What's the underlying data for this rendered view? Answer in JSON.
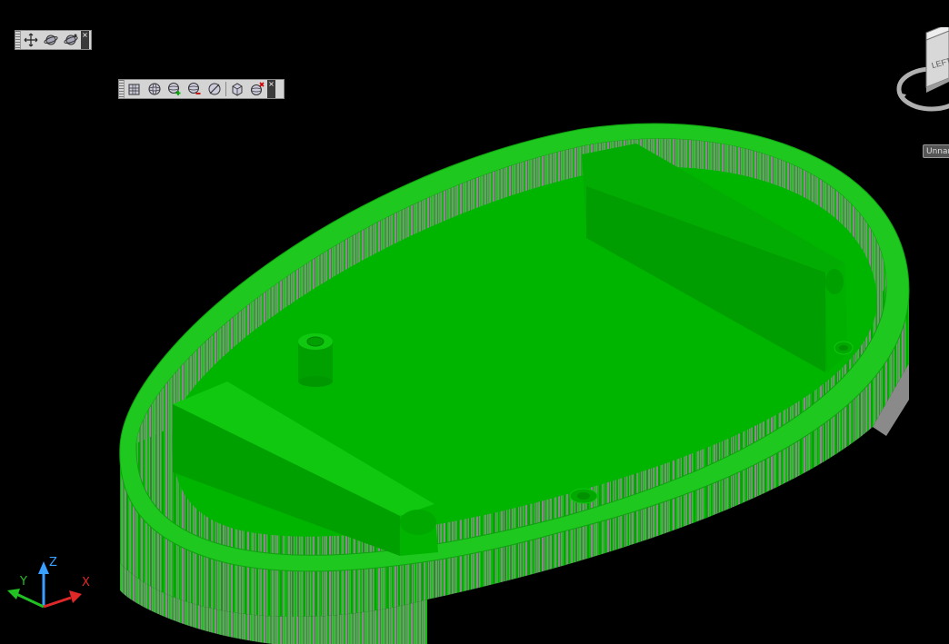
{
  "toolbars": {
    "navigate": {
      "buttons": [
        {
          "name": "pan-icon",
          "title": "Pan"
        },
        {
          "name": "orbit-icon",
          "title": "Orbit"
        },
        {
          "name": "free-orbit-icon",
          "title": "Free Orbit"
        }
      ]
    },
    "view": {
      "buttons": [
        {
          "name": "mesh-box-icon"
        },
        {
          "name": "sphere-icon"
        },
        {
          "name": "sphere-add-icon"
        },
        {
          "name": "sphere-subtract-icon"
        },
        {
          "name": "section-plane-icon"
        },
        {
          "name": "box-view-icon"
        },
        {
          "name": "sphere-delete-icon"
        }
      ]
    }
  },
  "viewcube": {
    "face_label": "LEFT",
    "view_name": "Unnamed"
  },
  "ucs": {
    "x_label": "X",
    "y_label": "Y",
    "z_label": "Z"
  },
  "colors": {
    "background": "#000000",
    "model_face": "#00b800",
    "model_wall": "#8a8a8a",
    "x_axis": "#e02020",
    "y_axis": "#20c020",
    "z_axis": "#2080e0"
  }
}
